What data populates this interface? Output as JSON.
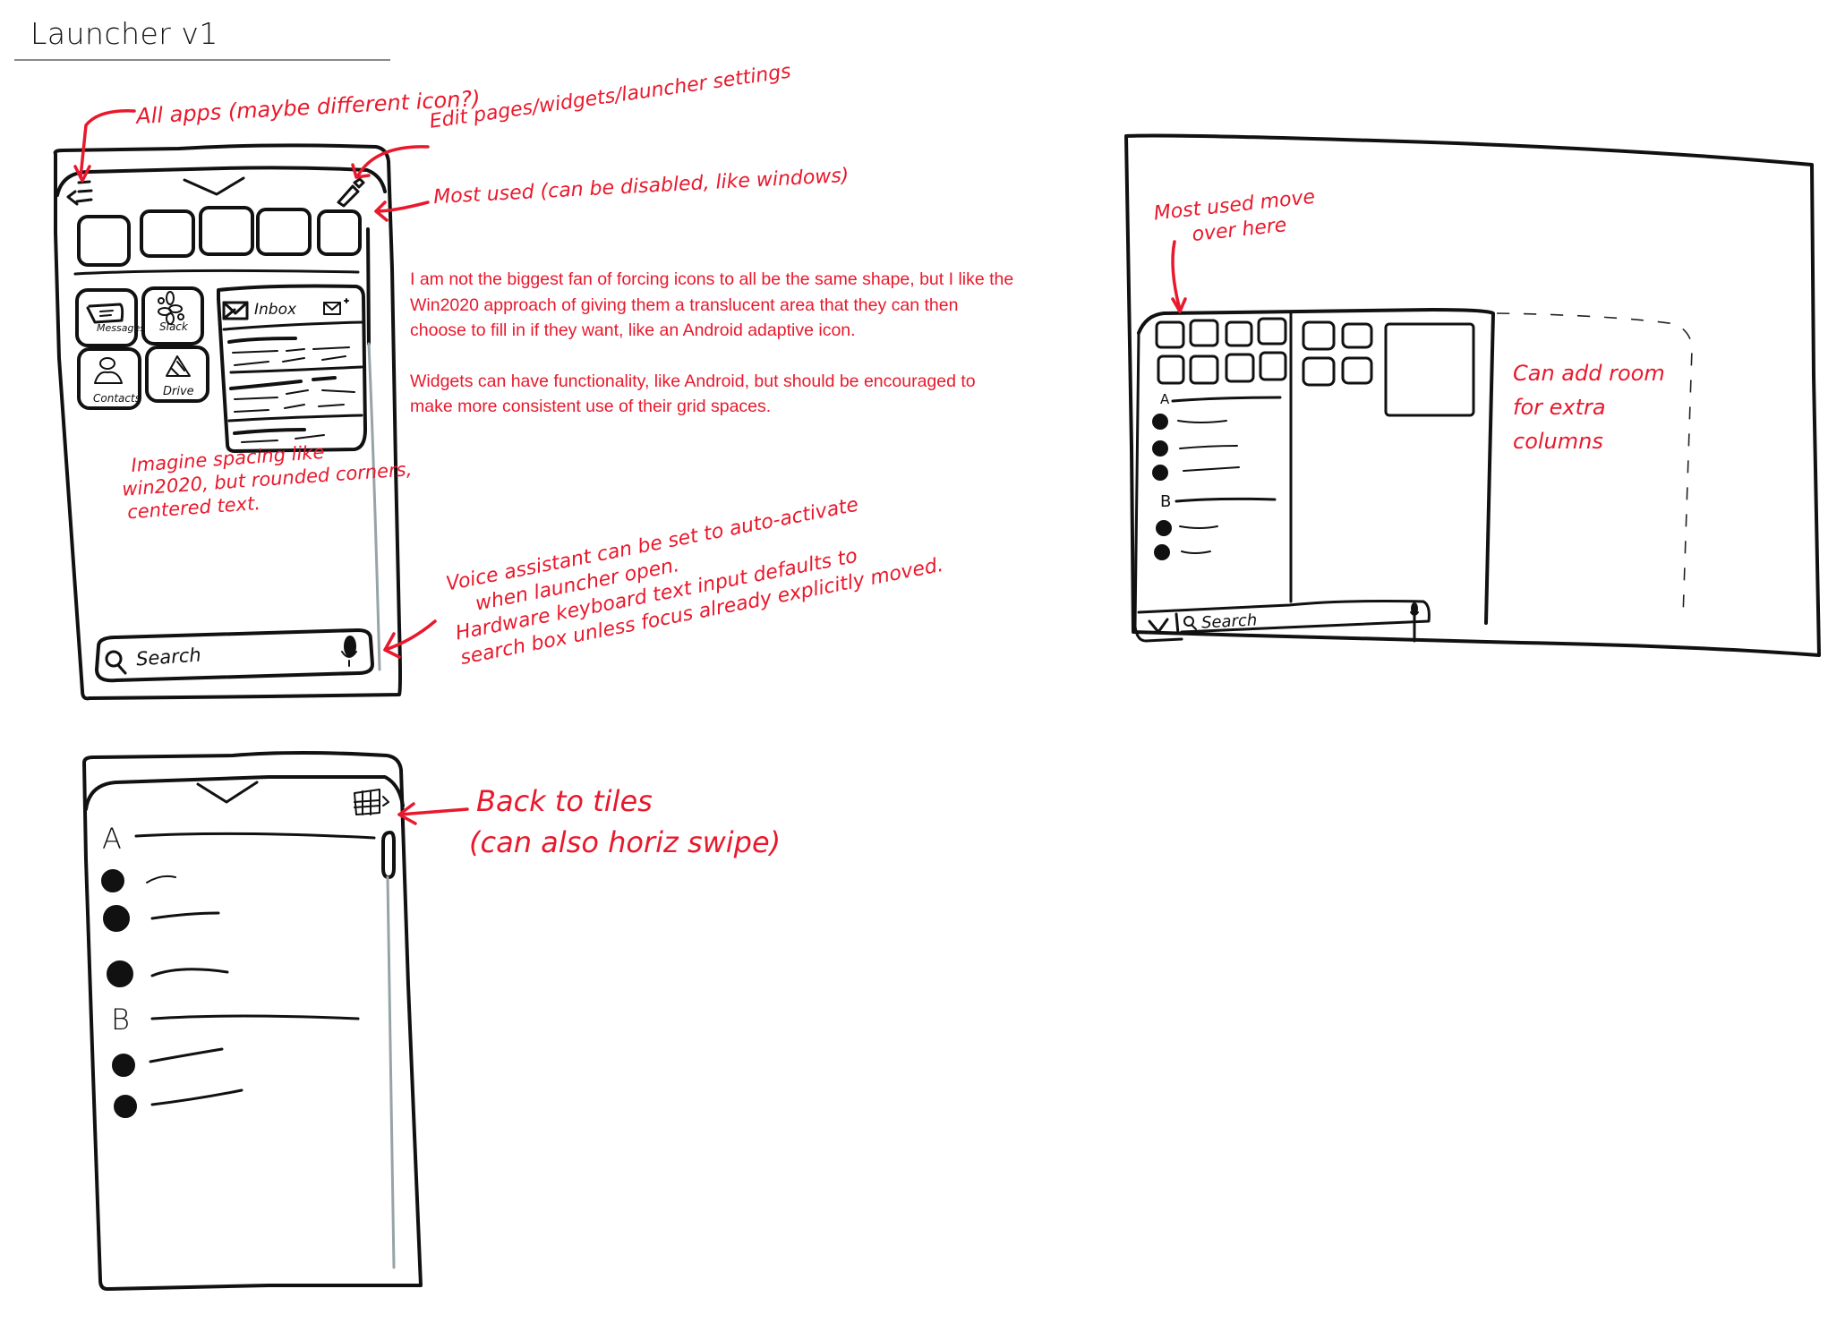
{
  "page": {
    "title": "Launcher v1"
  },
  "annotations": {
    "all_apps": "All apps (maybe different icon?)",
    "edit_pages": "Edit pages/widgets/launcher settings",
    "most_used": "Most used (can be disabled, like windows)",
    "spacing": [
      "Imagine spacing like",
      "win2020, but rounded corners,",
      "centered text."
    ],
    "voice": [
      "Voice assistant can be set to auto-activate",
      "when launcher open.",
      "Hardware keyboard text input defaults to",
      "search box unless focus already explicitly moved."
    ],
    "back_to_tiles": [
      "Back to tiles",
      "(can also horiz swipe)"
    ],
    "most_used_move": [
      "Most used move",
      "over here"
    ],
    "add_room": [
      "Can add room",
      "for extra",
      "columns"
    ]
  },
  "notes": {
    "paragraph_1": "I am not the biggest fan of forcing icons to all be the same shape, but I like the Win2020 approach of giving them a translucent area that they can then choose to fill in if they want, like an Android adaptive icon.",
    "paragraph_2": "Widgets can have functionality, like Android, but should be encouraged to make more consistent use of their grid spaces."
  },
  "phone_tiles": {
    "header_icons": [
      "all-apps-icon",
      "collapse-chevron-icon",
      "edit-pencil-icon"
    ],
    "most_used_slots": 5,
    "tiles": [
      {
        "label": "Messages",
        "icon": "chat-bubble-icon"
      },
      {
        "label": "Slack",
        "icon": "slack-icon"
      },
      {
        "label": "Contacts",
        "icon": "person-icon"
      },
      {
        "label": "Drive",
        "icon": "drive-triangle-icon"
      }
    ],
    "widget": {
      "title": "Inbox",
      "icon": "mail-icon",
      "action_icon": "compose-mail-icon"
    },
    "search": {
      "placeholder": "Search",
      "icon": "search-icon",
      "mic_icon": "mic-icon"
    }
  },
  "phone_all_apps": {
    "header_icons": [
      "collapse-chevron-icon",
      "tiles-grid-icon"
    ],
    "sections": [
      {
        "letter": "A",
        "items": 3
      },
      {
        "letter": "B",
        "items": 2
      }
    ]
  },
  "desktop": {
    "most_used_grid": {
      "rows": 2,
      "cols": 4
    },
    "sections": [
      {
        "letter": "A",
        "items": 3
      },
      {
        "letter": "B",
        "items": 2
      }
    ],
    "search": {
      "placeholder": "Search",
      "collapse_label": "V"
    }
  },
  "colors": {
    "annotation": "#e8192c",
    "sketch": "#111111",
    "scrollbar": "#97a3a8"
  }
}
